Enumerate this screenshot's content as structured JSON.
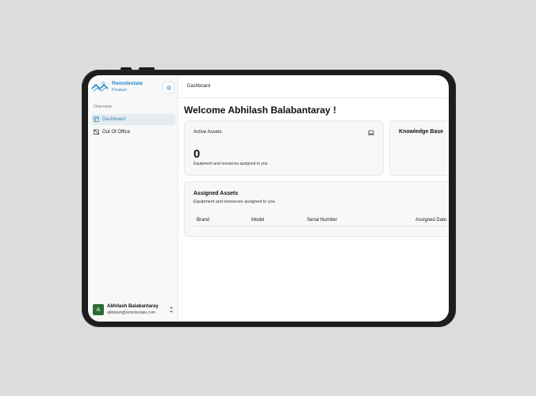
{
  "brand": {
    "name": "Remotestate",
    "sub": "Product"
  },
  "sidebar": {
    "section": "Overview",
    "items": [
      {
        "label": "Dashboard",
        "icon": "dashboard-icon"
      },
      {
        "label": "Out Of Office",
        "icon": "calendar-off-icon"
      }
    ]
  },
  "user": {
    "initial": "A",
    "name": "Abhilash Balabantaray",
    "email": "abhilash@remotestate.com"
  },
  "topbar": {
    "breadcrumb": "Dashboard"
  },
  "main": {
    "welcome": "Welcome Abhilash Balabantaray !",
    "active_assets": {
      "label": "Active Assets",
      "value": "0",
      "desc": "Equipment and resources assigned to you",
      "icon": "laptop-icon"
    },
    "knowledge_base": {
      "title": "Knowledge Base"
    },
    "assigned": {
      "title": "Assigned Assets",
      "desc": "Equipment and resources assigned to you",
      "columns": [
        "Brand",
        "Model",
        "Serial Number",
        "Assigned Date"
      ]
    }
  },
  "colors": {
    "accent": "#2a87c6",
    "avatar": "#2e6b2f",
    "card_bg": "#f7f8f8",
    "device_frame": "#1d1d1d"
  }
}
